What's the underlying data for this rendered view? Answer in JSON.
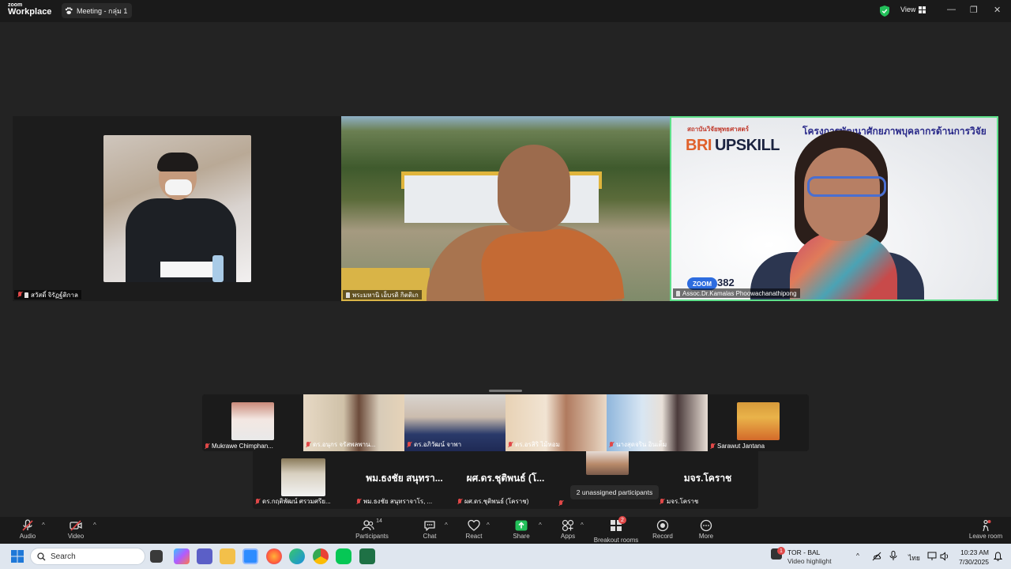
{
  "titlebar": {
    "logo_line1": "zoom",
    "logo_line2": "Workplace",
    "meeting_tab": "Meeting - กลุ่ม 1",
    "view_label": "View"
  },
  "main_tiles": [
    {
      "name": "สวัสดิ์ จิรัฏฐ์ติกาล"
    },
    {
      "name": "พระมหานิ เอ็บรดิ กิตติเก"
    },
    {
      "name": "Assoc.Dr.Kamalas Phoowachanathipong"
    }
  ],
  "slide": {
    "org": "สถาบันวิจัยพุทธศาสตร์",
    "logo_bri": "BRI",
    "logo_upskill": "UPSKILL",
    "project_title": "โครงการพัฒนาศักยภาพบุคลากรด้านการวิจัย",
    "zoom_badge": "ZOOM",
    "zoom_number": "382"
  },
  "strip_row1": [
    {
      "name": "Mukrawe Chimphan..."
    },
    {
      "name": "ดร.อนุกร จรัสพลพาน..."
    },
    {
      "name": "ดร.อภิวัฒน์ จาพา"
    },
    {
      "name": "ดร.อรสิริ ไม้หอม"
    },
    {
      "name": "นางสุดจริน อินเต็ม"
    },
    {
      "name": "Sarawut Jantana"
    }
  ],
  "strip_row2": [
    {
      "name": "ดร.กฤติพัฒน์ ศรวมศรีย..."
    },
    {
      "big": "พม.ธงชัย สนุทรา...",
      "name": "พม.ธงชัย สนุทราจาโร, ..."
    },
    {
      "big": "ผศ.ดร.ชุติพนธ์ (โ...",
      "name": "ผศ.ดร.ชุติพนธ์ (โคราช)"
    },
    {
      "name": ""
    },
    {
      "big": "มจร.โคราช",
      "name": "มจร.โคราช"
    }
  ],
  "tooltip": "2 unassigned participants",
  "toolbar": {
    "audio": "Audio",
    "video": "Video",
    "participants": "Participants",
    "participants_count": "14",
    "chat": "Chat",
    "react": "React",
    "share": "Share",
    "apps": "Apps",
    "breakout": "Breakout rooms",
    "breakout_badge": "2",
    "record": "Record",
    "more": "More",
    "leave": "Leave room"
  },
  "taskbar": {
    "search_placeholder": "Search",
    "notif_title": "TOR - BAL",
    "notif_sub": "Video highlight",
    "notif_badge": "1",
    "lang": "ไทย",
    "time": "10:23 AM",
    "date": "7/30/2025"
  },
  "colors": {
    "accent_green": "#5ee08a",
    "mute_red": "#e04848",
    "share_green": "#23c05a"
  }
}
